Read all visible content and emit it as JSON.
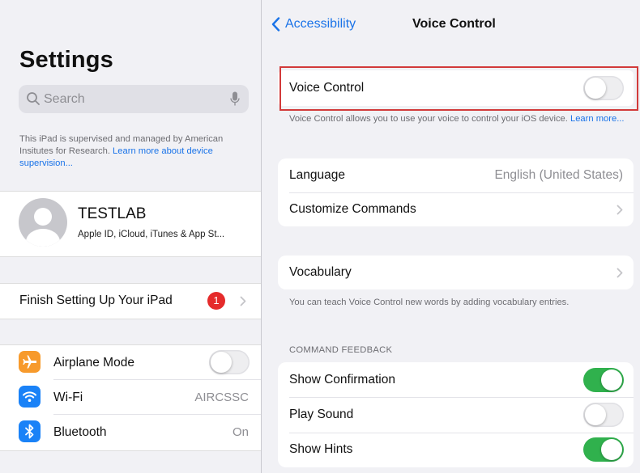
{
  "sidebar": {
    "title": "Settings",
    "search": {
      "placeholder": "Search"
    },
    "supervision": {
      "text": "This iPad is supervised and managed by American Insitutes for Research. ",
      "link": "Learn more about device supervision..."
    },
    "profile": {
      "name": "TESTLAB",
      "subtitle": "Apple ID, iCloud, iTunes & App St..."
    },
    "finish_setup": {
      "label": "Finish Setting Up Your iPad",
      "badge": "1"
    },
    "connectivity": [
      {
        "label": "Airplane Mode",
        "icon": "airplane-icon",
        "color": "#f79a2c",
        "switch": "off"
      },
      {
        "label": "Wi-Fi",
        "icon": "wifi-icon",
        "color": "#1a82f7",
        "value": "AIRCSSC"
      },
      {
        "label": "Bluetooth",
        "icon": "bluetooth-icon",
        "color": "#1a82f7",
        "value": "On"
      }
    ]
  },
  "nav": {
    "back_label": "Accessibility",
    "title": "Voice Control"
  },
  "voice_control": {
    "label": "Voice Control",
    "enabled": false,
    "description": "Voice Control allows you to use your voice to control your iOS device. ",
    "learn_more": "Learn more..."
  },
  "language_group": {
    "language_label": "Language",
    "language_value": "English (United States)",
    "customize_label": "Customize Commands"
  },
  "vocabulary": {
    "label": "Vocabulary",
    "description": "You can teach Voice Control new words by adding vocabulary entries."
  },
  "command_feedback": {
    "header": "COMMAND FEEDBACK",
    "items": [
      {
        "label": "Show Confirmation",
        "enabled": true
      },
      {
        "label": "Play Sound",
        "enabled": false
      },
      {
        "label": "Show Hints",
        "enabled": true
      }
    ]
  },
  "colors": {
    "accent": "#1a73e8",
    "switch_on": "#30b14d",
    "badge": "#e52b2b",
    "highlight": "#d23a3a"
  }
}
